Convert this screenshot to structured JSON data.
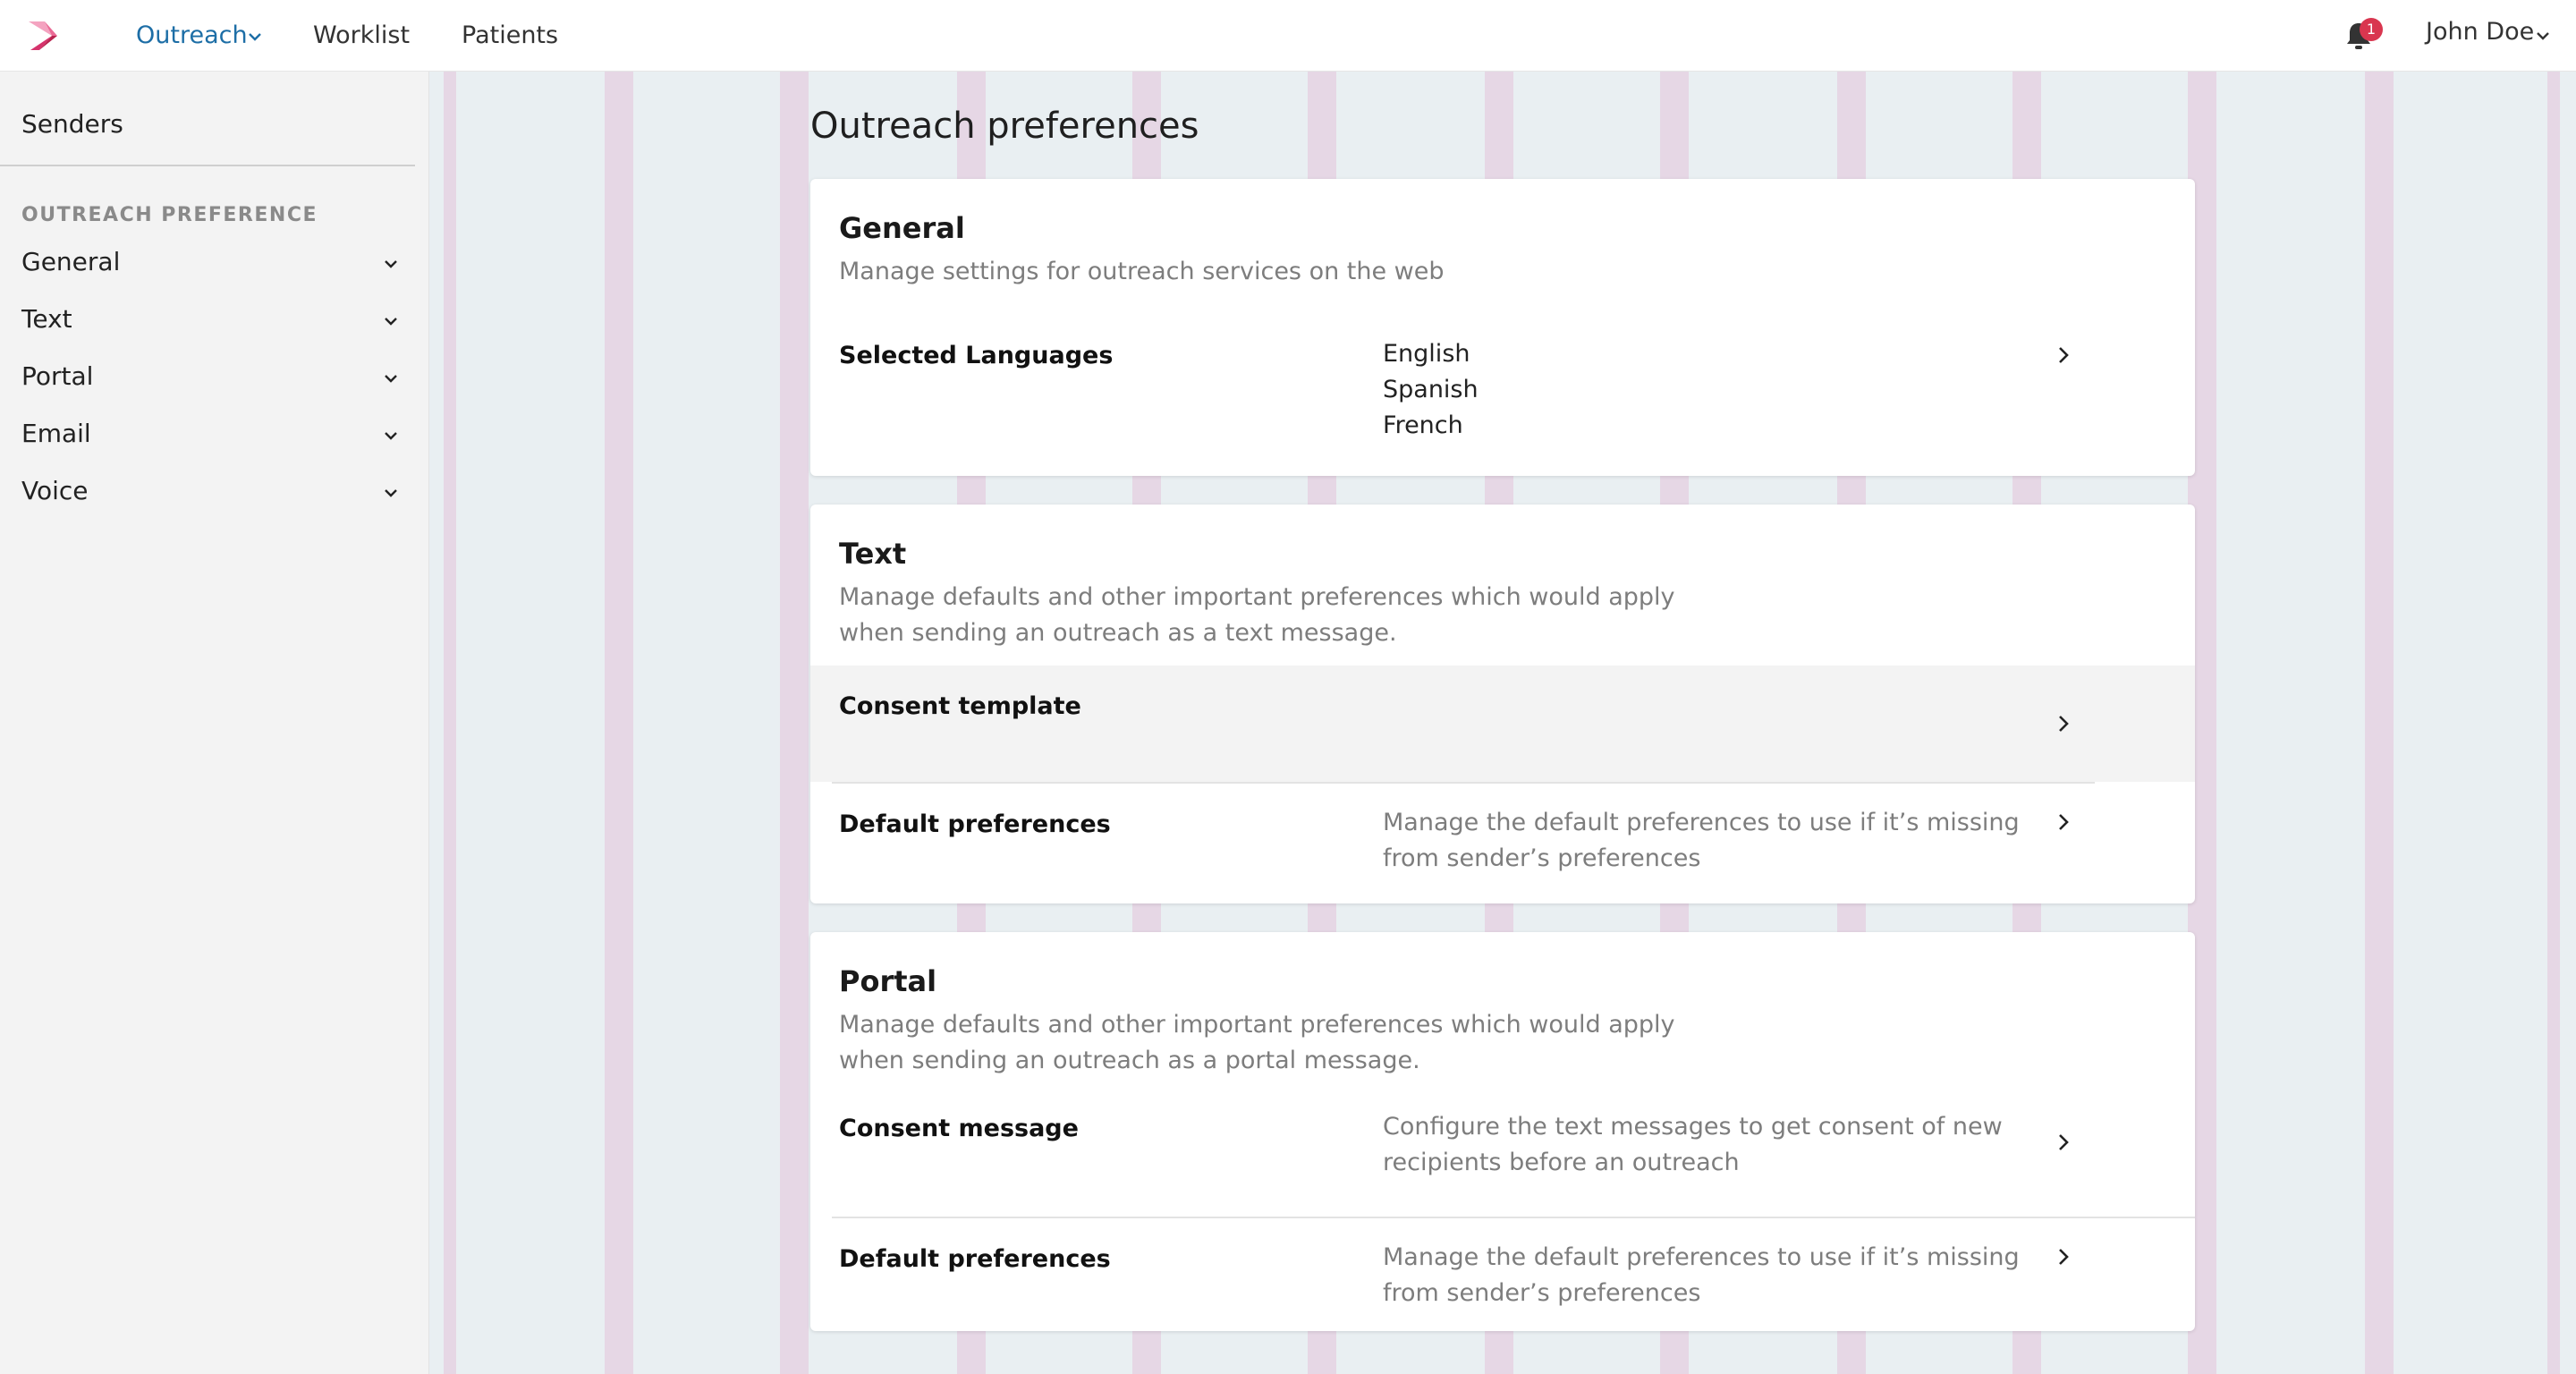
{
  "header": {
    "nav": [
      {
        "label": "Outreach",
        "active": true,
        "has_dropdown": true
      },
      {
        "label": "Worklist"
      },
      {
        "label": "Patients"
      }
    ],
    "notifications": {
      "count": "1",
      "icon": "bell-icon"
    },
    "user": {
      "name": "John Doe"
    }
  },
  "sidebar": {
    "senders_label": "Senders",
    "section_heading": "OUTREACH PREFERENCE",
    "items": [
      {
        "label": "General"
      },
      {
        "label": "Text"
      },
      {
        "label": "Portal"
      },
      {
        "label": "Email"
      },
      {
        "label": "Voice"
      }
    ]
  },
  "main": {
    "title": "Outreach preferences",
    "cards": [
      {
        "title": "General",
        "description": "Manage settings for outreach services on the web",
        "rows": [
          {
            "label": "Selected Languages",
            "values": [
              "English",
              "Spanish",
              "French"
            ]
          }
        ]
      },
      {
        "title": "Text",
        "description": "Manage defaults and other important preferences which would apply when sending an outreach as a text message.",
        "rows": [
          {
            "label": "Consent template",
            "value": ""
          },
          {
            "label": "Default preferences",
            "value": "Manage the default preferences to use if it’s missing from sender’s preferences"
          }
        ]
      },
      {
        "title": "Portal",
        "description": "Manage defaults and other important preferences which would apply when sending an outreach as a portal message.",
        "rows": [
          {
            "label": "Consent message",
            "value": "Configure the text messages to get consent of new recipients before an outreach"
          },
          {
            "label": "Default preferences",
            "value": "Manage the default preferences to use if it’s missing from sender’s preferences"
          }
        ]
      }
    ]
  },
  "colors": {
    "accent": "#1d6ea6",
    "badge": "#d9364f",
    "grid_stripe": "#e6d7e5",
    "main_bg": "#e9eff2",
    "sidebar_bg": "#f3f3f3",
    "hover_row": "#f3f3f3"
  }
}
